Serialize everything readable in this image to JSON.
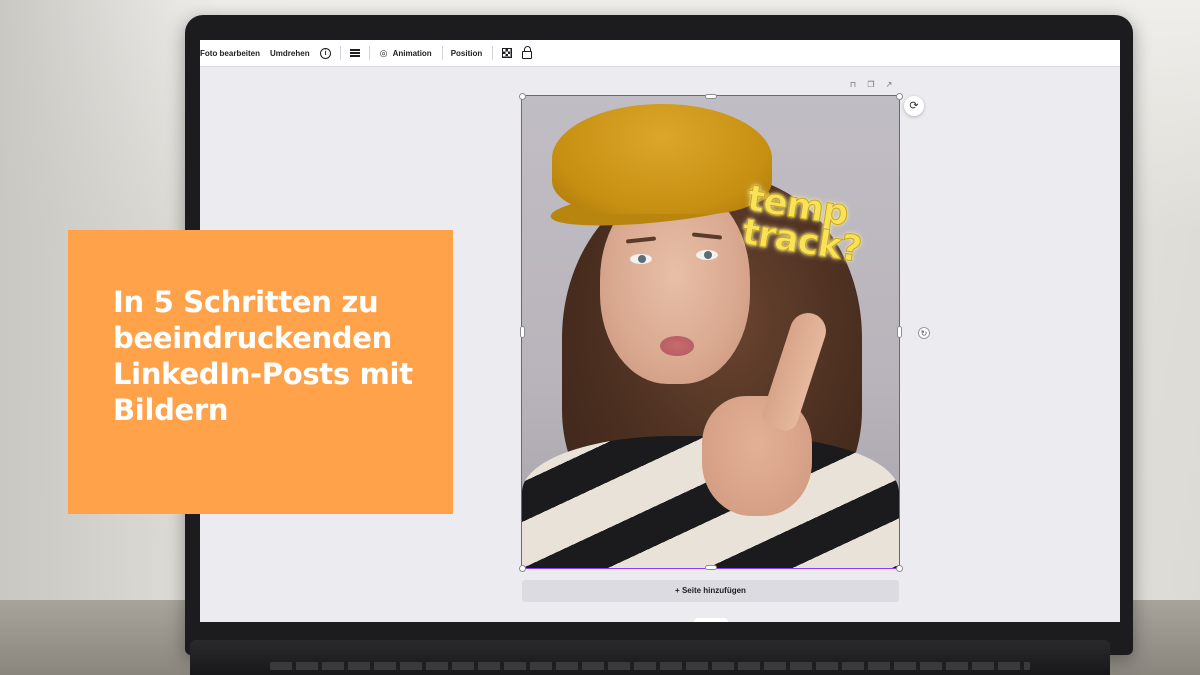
{
  "toolbar": {
    "items": [
      {
        "label": "Foto bearbeiten"
      },
      {
        "label": "Umdrehen"
      },
      {
        "label": "Animation"
      },
      {
        "label": "Position"
      }
    ],
    "icons": [
      "info-icon",
      "menu-icon",
      "animation-icon",
      "transparency-icon",
      "lock-icon"
    ]
  },
  "canvas": {
    "sticker_text": "temp\ntrack?",
    "add_page_label": "+ Seite hinzufügen"
  },
  "overlay": {
    "headline": "In 5 Schritten zu beeindruckenden LinkedIn-Posts mit Bildern",
    "background_color": "#ffa24a"
  },
  "colors": {
    "accent_selection": "#8b3dff",
    "sticker": "#f7e25a"
  }
}
